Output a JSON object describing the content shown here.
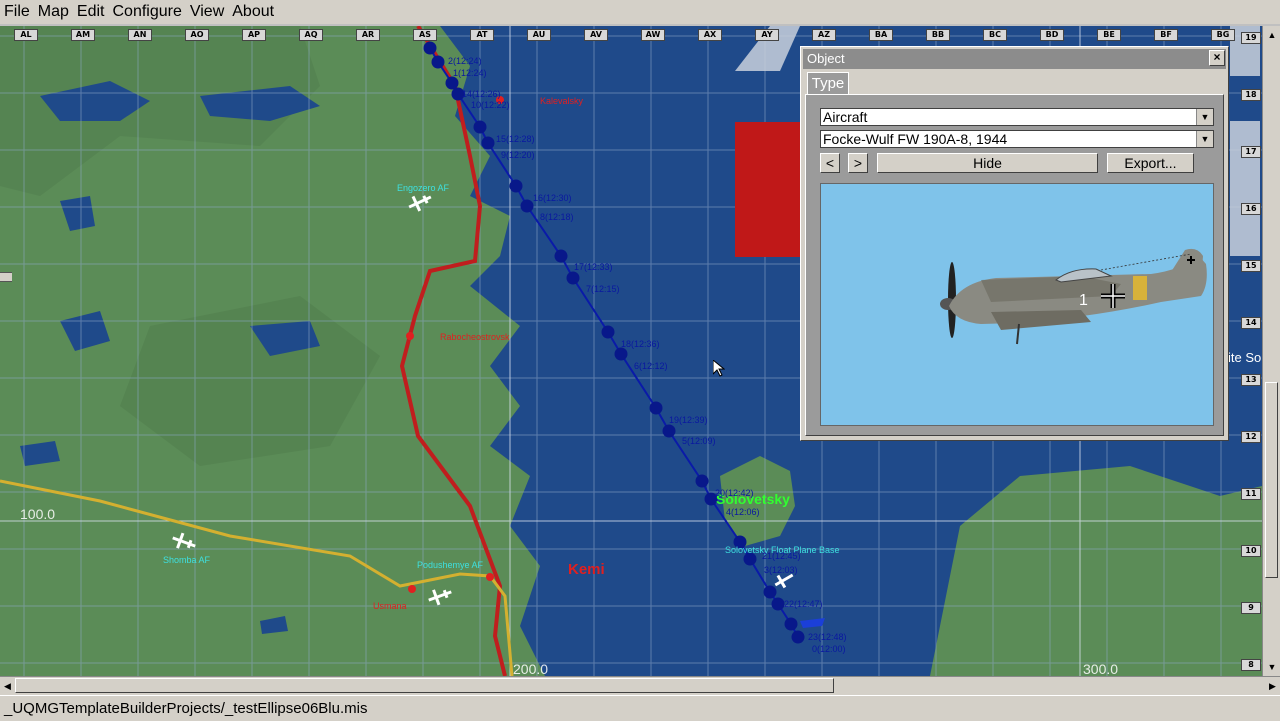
{
  "menu": [
    "File",
    "Map",
    "Edit",
    "Configure",
    "View",
    "About"
  ],
  "map": {
    "col_headers": [
      "AL",
      "AM",
      "AN",
      "AO",
      "AP",
      "AQ",
      "AR",
      "AS",
      "AT",
      "AU",
      "AV",
      "AW",
      "AX",
      "AY",
      "AZ",
      "BA",
      "BB",
      "BC",
      "BD",
      "BE",
      "BF",
      "BG"
    ],
    "row_headers": [
      "19",
      "18",
      "17",
      "16",
      "15",
      "14",
      "13",
      "12",
      "11",
      "10",
      "9",
      "8"
    ],
    "coord_labels": {
      "y100": "100.0",
      "x200": "200.0",
      "x300": "300.0"
    },
    "places": {
      "engozero": "Engozero AF",
      "kalevala": "Kalevalsky",
      "shomba": "Shomba AF",
      "podushemye": "Podushemye AF",
      "usmana": "Usmana",
      "kemi": "Kemi",
      "solovetsky": "Solovetsky",
      "solovetsky_base": "Solovetsky Float Plane Base",
      "red_town": "Rabocheostrovsk",
      "edge_text": "ite So"
    },
    "waypoints": [
      "2(12:24)",
      "1(12:24)",
      "14(12:26)",
      "10(12:22)",
      "15(12:28)",
      "9(12:20)",
      "16(12:30)",
      "8(12:18)",
      "17(12:33)",
      "7(12:15)",
      "18(12:36)",
      "6(12:12)",
      "19(12:39)",
      "5(12:09)",
      "20(12:42)",
      "4(12:06)",
      "21(12:45)",
      "3(12:03)",
      "22(12:47)",
      "23(12:48)",
      "0(12:00)"
    ]
  },
  "object_window": {
    "title": "Object",
    "close": "×",
    "tab": "Type",
    "category": "Aircraft",
    "model": "Focke-Wulf FW 190A-8, 1944",
    "prev": "<",
    "next": ">",
    "hide": "Hide",
    "export": "Export...",
    "marking": "1"
  },
  "status_path": "_UQMGTemplateBuilderProjects/_testEllipse06Blu.mis",
  "colors": {
    "water": "#1f4a8a",
    "land": "#5b8c57",
    "route": "#0a1aa8",
    "border": "#c01e1e",
    "road": "#d4b030"
  }
}
